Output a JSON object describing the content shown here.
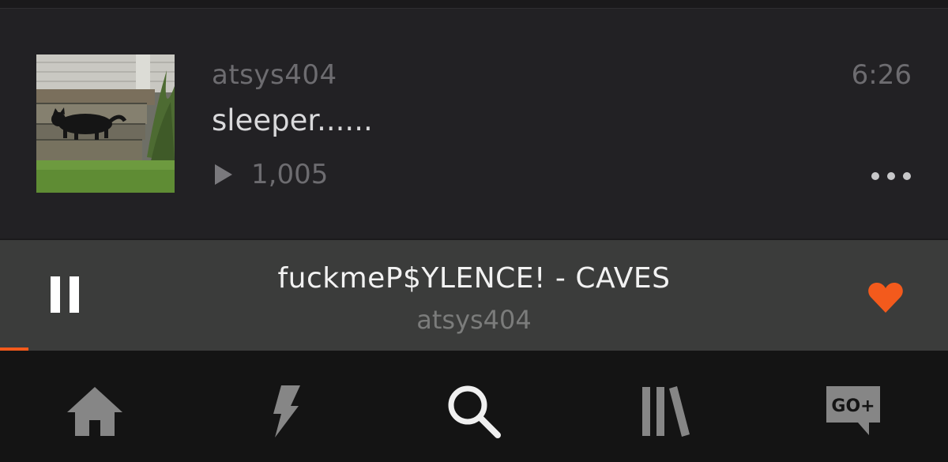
{
  "track": {
    "username": "atsys404",
    "title": "sleeper......",
    "duration": "6:26",
    "plays": "1,005",
    "artwork_icon": "cat-on-steps-artwork",
    "play_icon": "play-icon",
    "more_icon": "more-dots-icon"
  },
  "player": {
    "title": "fuckmeP$YLENCE! - CAVES",
    "username": "atsys404",
    "progress": 0.03,
    "pause_icon": "pause-icon",
    "like_icon": "heart-icon",
    "accent_color": "#f35a1c"
  },
  "nav": {
    "items": [
      {
        "name": "home",
        "icon": "home-icon",
        "active": false
      },
      {
        "name": "stream",
        "icon": "lightning-icon",
        "active": false
      },
      {
        "name": "search",
        "icon": "search-icon",
        "active": true
      },
      {
        "name": "library",
        "icon": "library-icon",
        "active": false
      },
      {
        "name": "go-plus",
        "icon": "go-plus-icon",
        "label": "GO+",
        "active": false
      }
    ]
  },
  "colors": {
    "background": "#222124",
    "player_background": "#3b3c3b",
    "nav_background": "#141414",
    "muted_text": "#6d6c70",
    "nav_icon_inactive": "#868686",
    "nav_icon_active": "#f0f0f0"
  }
}
